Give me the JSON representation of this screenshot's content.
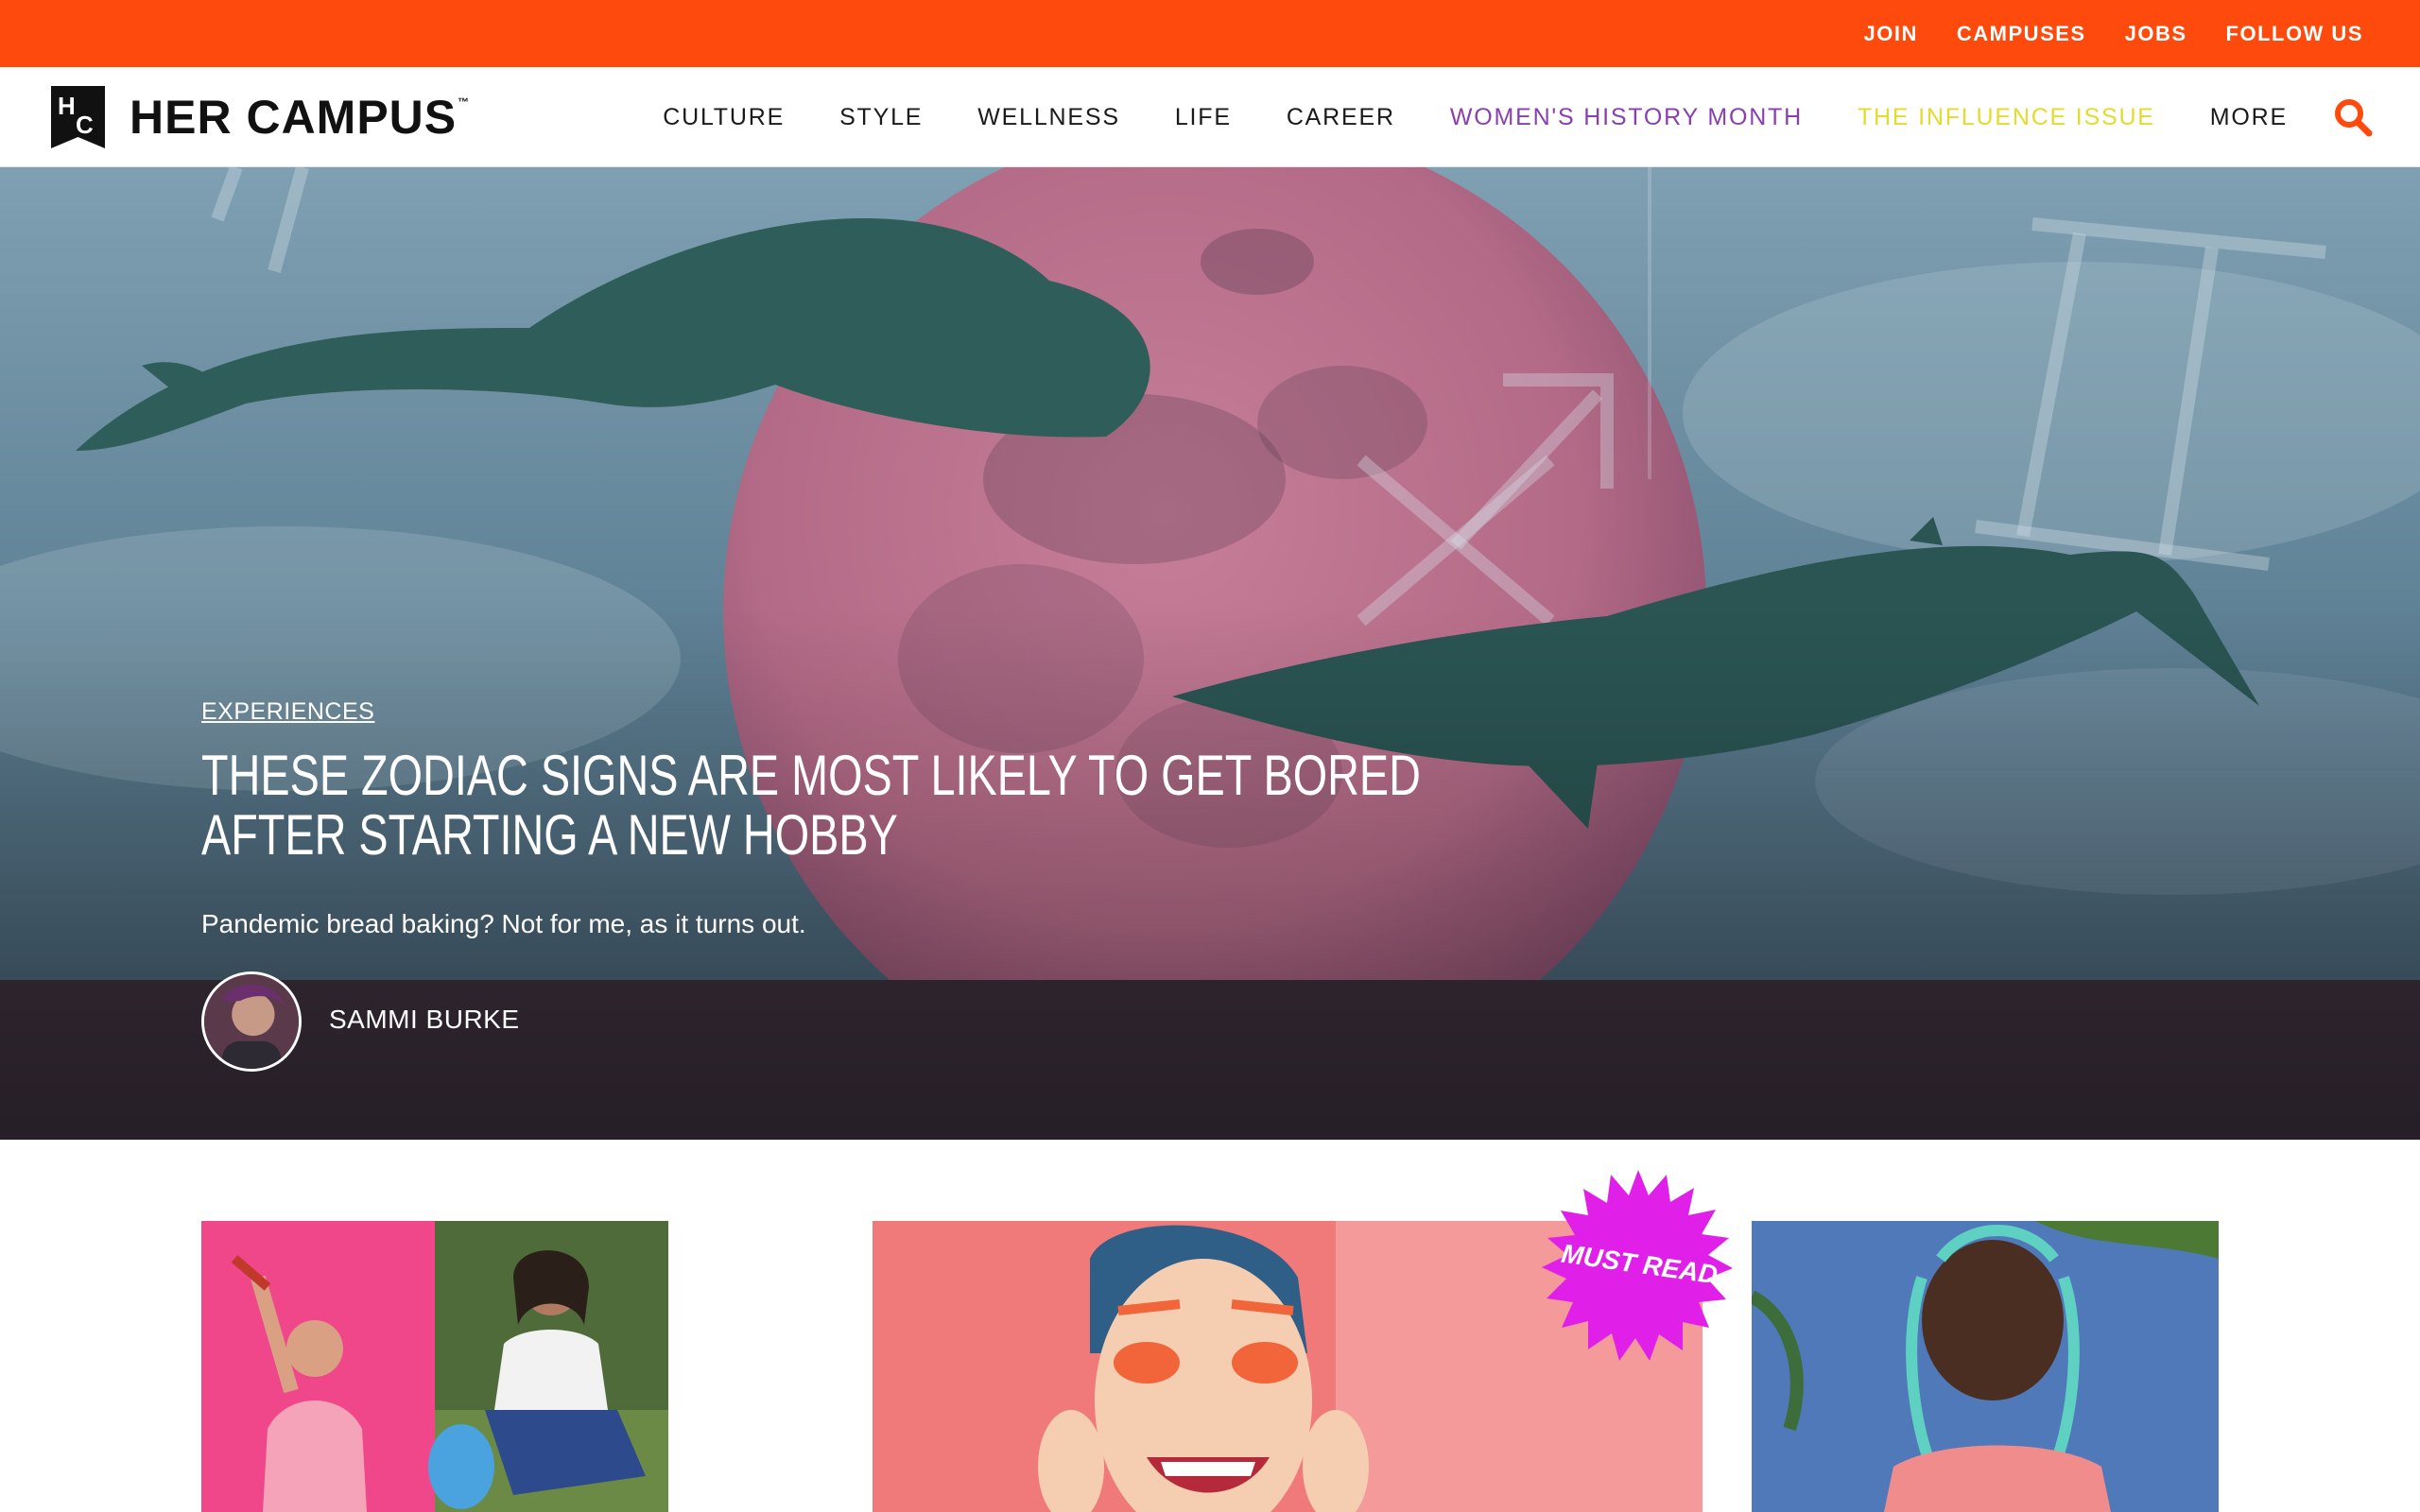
{
  "topbar": {
    "links": [
      "JOIN",
      "CAMPUSES",
      "JOBS",
      "FOLLOW US"
    ]
  },
  "header": {
    "logo_text": "HER CAMPUS",
    "logo_mark_top": "H",
    "logo_mark_bottom": "C",
    "trademark": "™",
    "nav": [
      {
        "label": "CULTURE"
      },
      {
        "label": "STYLE"
      },
      {
        "label": "WELLNESS"
      },
      {
        "label": "LIFE"
      },
      {
        "label": "CAREER"
      },
      {
        "label": "WOMEN'S HISTORY MONTH"
      },
      {
        "label": "THE INFLUENCE ISSUE"
      },
      {
        "label": "MORE"
      }
    ]
  },
  "hero": {
    "category": "EXPERIENCES",
    "title": "THESE ZODIAC SIGNS ARE MOST LIKELY TO GET BORED AFTER STARTING A NEW HOBBY",
    "dek": "Pandemic bread baking? Not for me, as it turns out.",
    "author": "SAMMI BURKE"
  },
  "cards": {
    "badge": "MUST READ"
  },
  "colors": {
    "brand_orange": "#ff4a0d",
    "whm_purple": "#8a3fb0",
    "influence_yellow": "#e3dc2e",
    "badge_magenta": "#e020e8"
  }
}
